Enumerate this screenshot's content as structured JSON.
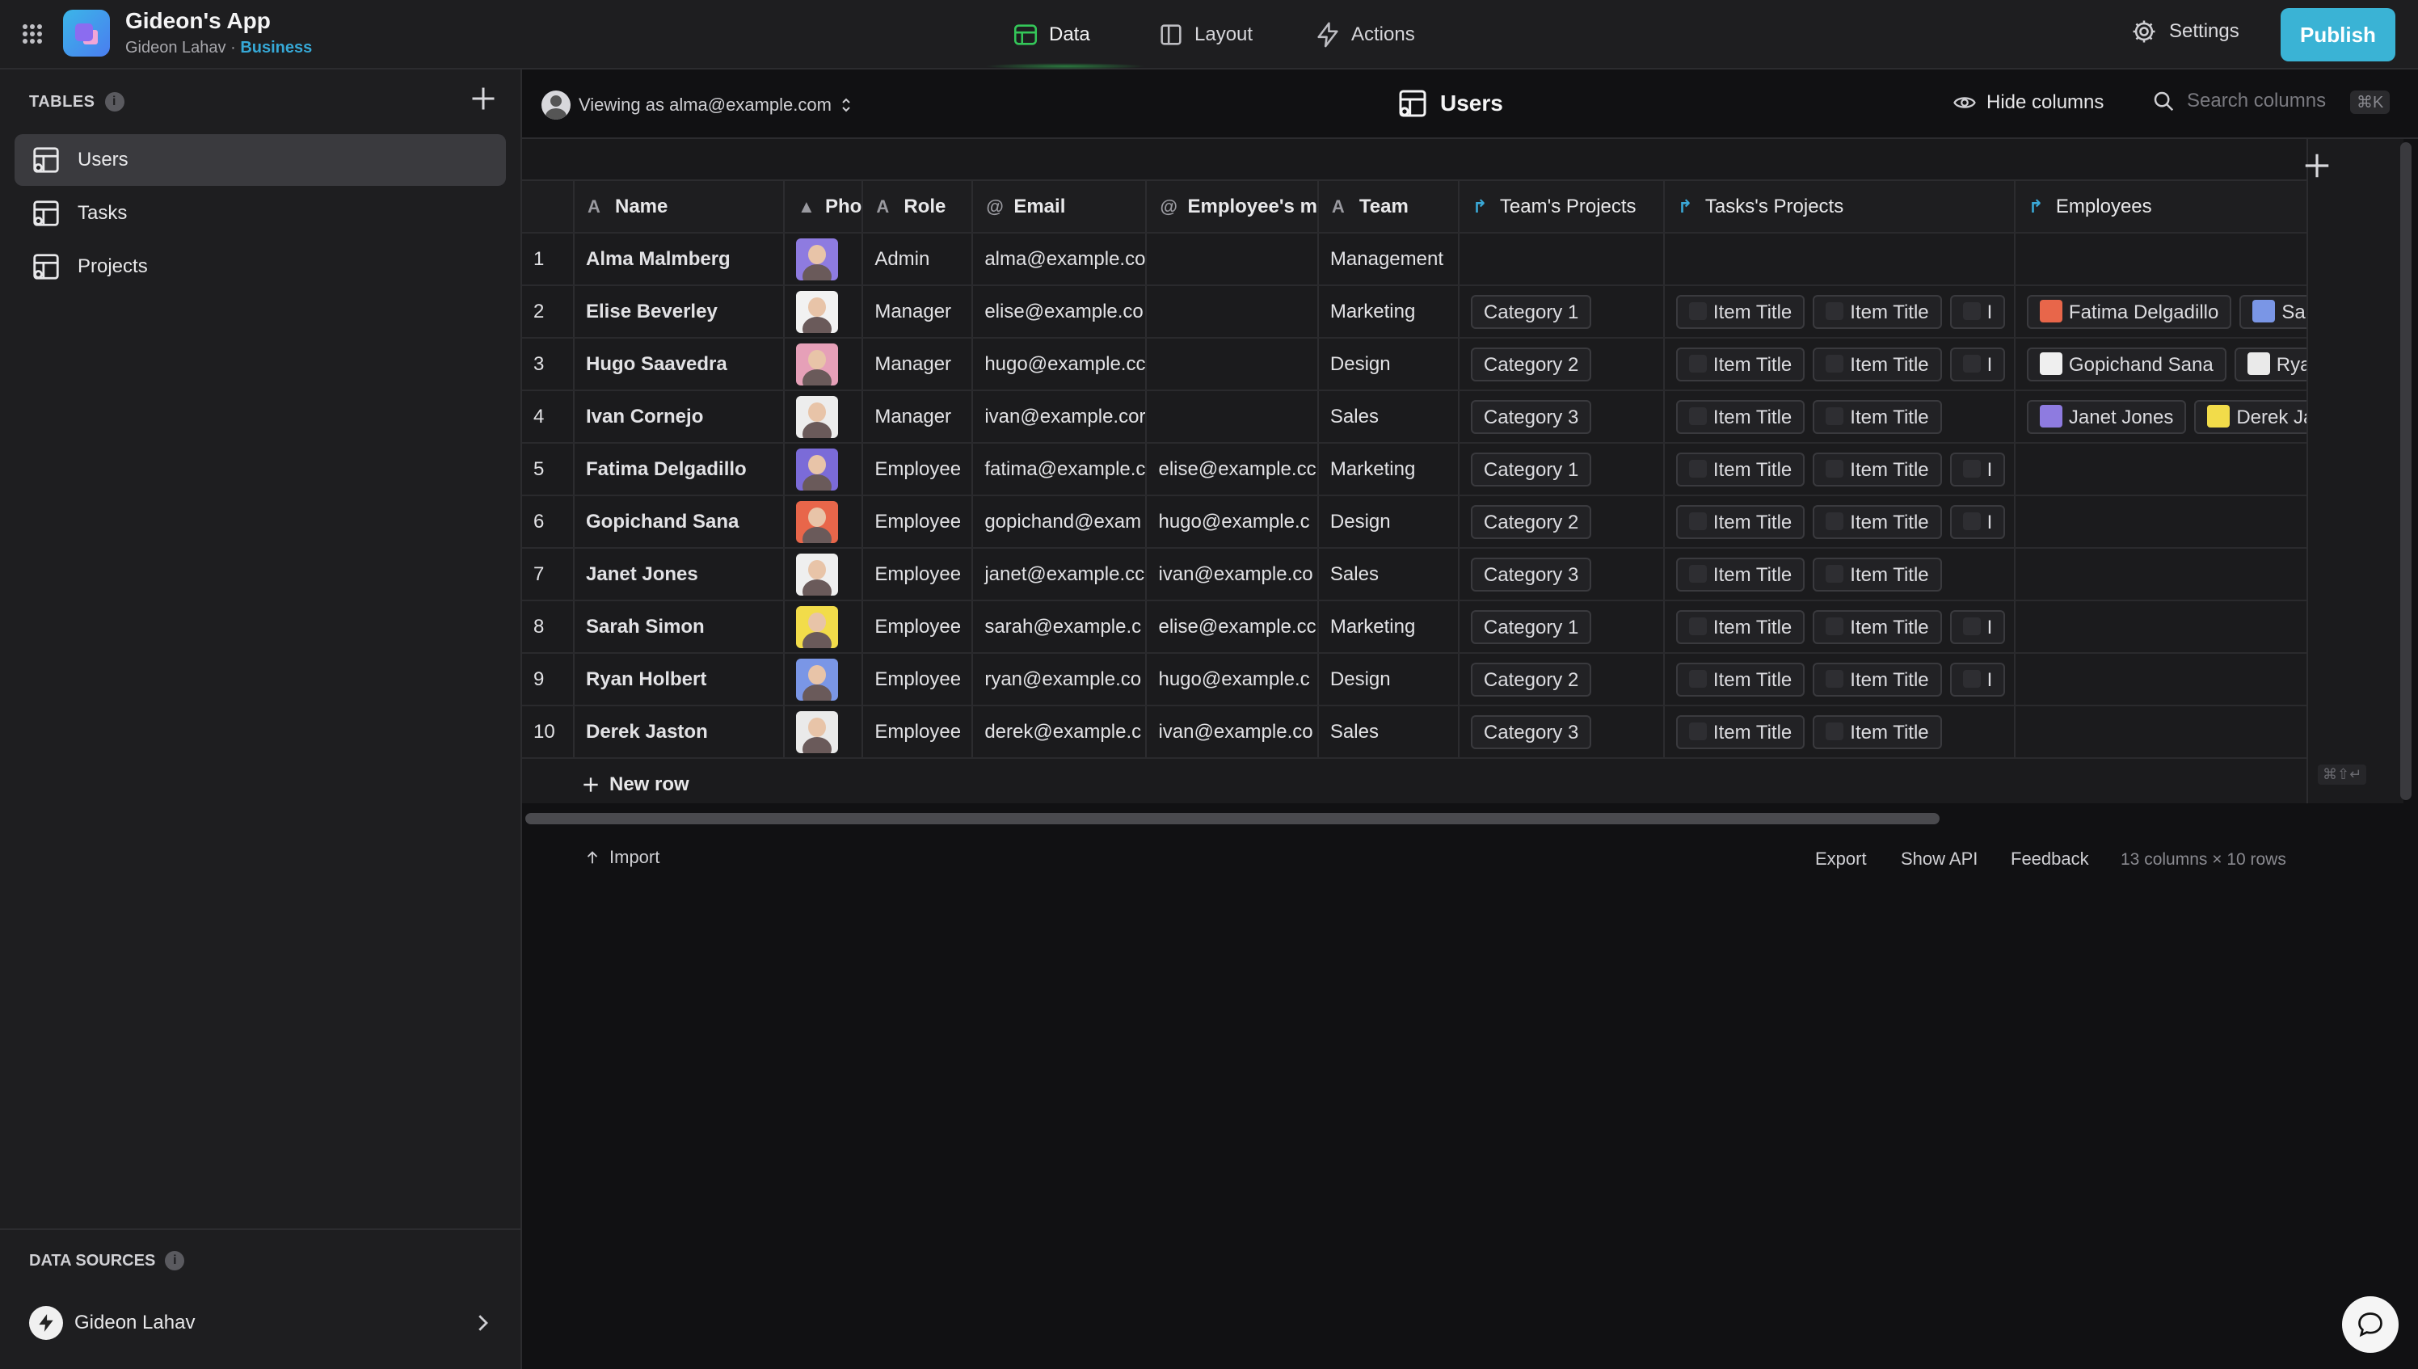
{
  "app": {
    "title": "Gideon's App",
    "owner": "Gideon Lahav",
    "separator": " · ",
    "plan": "Business"
  },
  "nav": {
    "data": "Data",
    "layout": "Layout",
    "actions": "Actions",
    "settings": "Settings",
    "publish": "Publish"
  },
  "sidebar": {
    "tables_heading": "TABLES",
    "info": "i",
    "tables": [
      {
        "label": "Users"
      },
      {
        "label": "Tasks"
      },
      {
        "label": "Projects"
      }
    ],
    "datasources_heading": "DATA SOURCES",
    "datasource": "Gideon Lahav"
  },
  "toolbar": {
    "viewing": "Viewing as alma@example.com",
    "table_title": "Users",
    "hide_columns": "Hide columns",
    "search_placeholder": "Search columns",
    "search_shortcut": "⌘K"
  },
  "columns": {
    "name": "Name",
    "photo": "Pho",
    "role": "Role",
    "email": "Email",
    "manager": "Employee's m",
    "team": "Team",
    "team_projects": "Team's Projects",
    "task_projects": "Tasks's Projects",
    "employees": "Employees"
  },
  "rows": [
    {
      "n": "1",
      "name": "Alma Malmberg",
      "role": "Admin",
      "email": "alma@example.co",
      "manager": "",
      "team": "Management",
      "cat": "",
      "tasks": []
    },
    {
      "n": "2",
      "name": "Elise Beverley",
      "role": "Manager",
      "email": "elise@example.co",
      "manager": "",
      "team": "Marketing",
      "cat": "Category 1",
      "tasks": [
        "Item Title",
        "Item Title",
        "I"
      ],
      "emps": [
        "Fatima Delgadillo",
        "Sar"
      ]
    },
    {
      "n": "3",
      "name": "Hugo Saavedra",
      "role": "Manager",
      "email": "hugo@example.cc",
      "manager": "",
      "team": "Design",
      "cat": "Category 2",
      "tasks": [
        "Item Title",
        "Item Title",
        "I"
      ],
      "emps": [
        "Gopichand Sana",
        "Ryan"
      ]
    },
    {
      "n": "4",
      "name": "Ivan Cornejo",
      "role": "Manager",
      "email": "ivan@example.cor",
      "manager": "",
      "team": "Sales",
      "cat": "Category 3",
      "tasks": [
        "Item Title",
        "Item Title"
      ],
      "emps": [
        "Janet Jones",
        "Derek Ja"
      ]
    },
    {
      "n": "5",
      "name": "Fatima Delgadillo",
      "role": "Employee",
      "email": "fatima@example.c",
      "manager": "elise@example.cc",
      "team": "Marketing",
      "cat": "Category 1",
      "tasks": [
        "Item Title",
        "Item Title",
        "I"
      ]
    },
    {
      "n": "6",
      "name": "Gopichand Sana",
      "role": "Employee",
      "email": "gopichand@exam",
      "manager": "hugo@example.c",
      "team": "Design",
      "cat": "Category 2",
      "tasks": [
        "Item Title",
        "Item Title",
        "I"
      ]
    },
    {
      "n": "7",
      "name": "Janet Jones",
      "role": "Employee",
      "email": "janet@example.cc",
      "manager": "ivan@example.co",
      "team": "Sales",
      "cat": "Category 3",
      "tasks": [
        "Item Title",
        "Item Title"
      ]
    },
    {
      "n": "8",
      "name": "Sarah Simon",
      "role": "Employee",
      "email": "sarah@example.c",
      "manager": "elise@example.cc",
      "team": "Marketing",
      "cat": "Category 1",
      "tasks": [
        "Item Title",
        "Item Title",
        "I"
      ]
    },
    {
      "n": "9",
      "name": "Ryan Holbert",
      "role": "Employee",
      "email": "ryan@example.co",
      "manager": "hugo@example.c",
      "team": "Design",
      "cat": "Category 2",
      "tasks": [
        "Item Title",
        "Item Title",
        "I"
      ]
    },
    {
      "n": "10",
      "name": "Derek Jaston",
      "role": "Employee",
      "email": "derek@example.c",
      "manager": "ivan@example.co",
      "team": "Sales",
      "cat": "Category 3",
      "tasks": [
        "Item Title",
        "Item Title"
      ]
    }
  ],
  "grid": {
    "new_row": "New row",
    "shortcut": "⌘⇧↵"
  },
  "footer": {
    "import": "Import",
    "export": "Export",
    "show_api": "Show API",
    "feedback": "Feedback",
    "count": "13 columns × 10 rows"
  },
  "colors": {
    "accent": "#3ab3d5",
    "plan": "#36a8d6",
    "data_nav_glow": "#34c759"
  },
  "photo_colors": [
    "#8e7be0",
    "#f2f2f2",
    "#e6a0b8",
    "#ededed",
    "#7b6bd8",
    "#e8664a",
    "#efefef",
    "#f2dc4a",
    "#7a96e6",
    "#eaeaea"
  ]
}
